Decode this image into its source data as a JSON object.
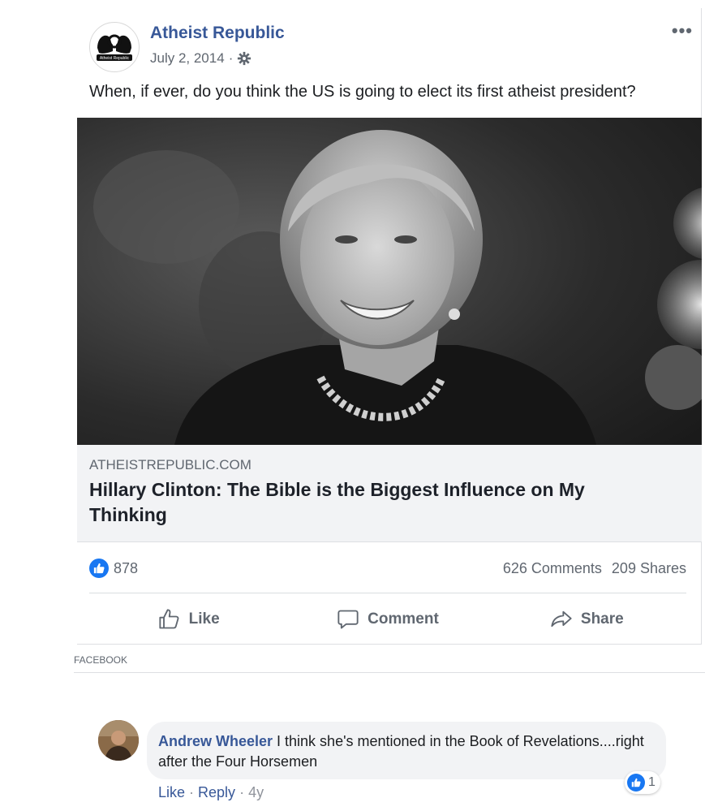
{
  "post": {
    "page_name": "Atheist Republic",
    "date": "July 2, 2014",
    "separator": "·",
    "text": "When, if ever, do you think the US is going to elect its first atheist president?",
    "more_icon": "more-options-icon",
    "audience_icon": "gear-icon",
    "logo_text": "Atheist Republic"
  },
  "link": {
    "domain": "ATHEISTREPUBLIC.COM",
    "title": "Hillary Clinton: The Bible is the Biggest Influence on My Thinking"
  },
  "stats": {
    "likes": "878",
    "comments": "626 Comments",
    "shares": "209 Shares"
  },
  "actions": {
    "like": "Like",
    "comment": "Comment",
    "share": "Share"
  },
  "source_label": "FACEBOOK",
  "comment": {
    "author": "Andrew Wheeler",
    "text": " I think she's mentioned in the Book of Revelations....right after the Four Horsemen",
    "like_label": "Like",
    "reply_label": "Reply",
    "time": "4y",
    "reaction_count": "1"
  },
  "colors": {
    "link_blue": "#385898",
    "like_blue": "#1877f2",
    "secondary_text": "#606770",
    "link_box_bg": "#f2f3f5"
  }
}
